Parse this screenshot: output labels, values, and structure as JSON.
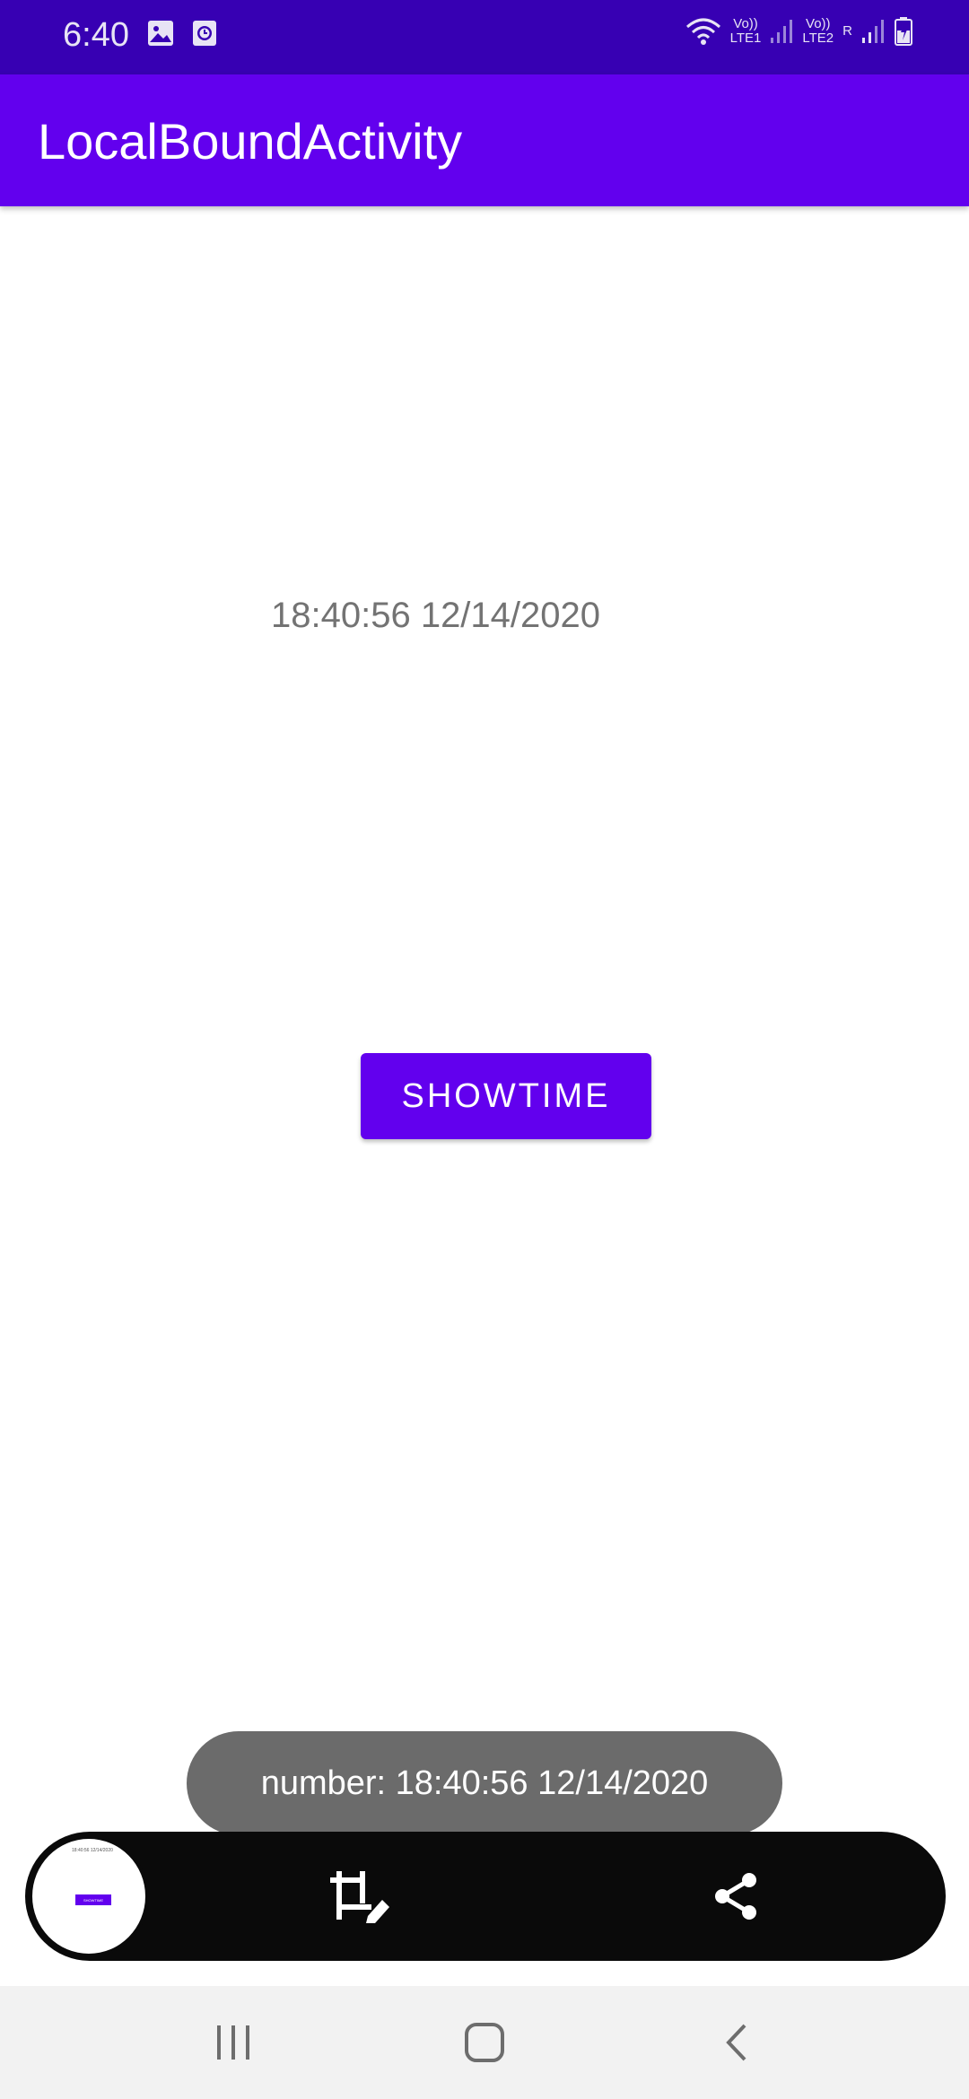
{
  "status_bar": {
    "time": "6:40",
    "sim1_label": "Vo))\nLTE1",
    "sim2_label": "Vo))\nLTE2",
    "roaming": "R",
    "icons": [
      "image-icon",
      "clock-icon",
      "wifi-icon",
      "signal-icon",
      "battery-icon"
    ]
  },
  "app_bar": {
    "title": "LocalBoundActivity"
  },
  "content": {
    "time_text": "18:40:56 12/14/2020",
    "showtime_label": "SHOWTIME"
  },
  "toast": {
    "message": "number: 18:40:56 12/14/2020"
  },
  "screenshot_toolbar": {
    "thumb_time_text": "18:40:56 12/14/2020",
    "thumb_button_label": "SHOWTIME",
    "icons": [
      "crop-edit-icon",
      "share-icon"
    ]
  },
  "nav_bar": {
    "icons": [
      "recents-icon",
      "home-icon",
      "back-icon"
    ]
  },
  "colors": {
    "status_bar": "#3700b3",
    "primary": "#6200ee",
    "toast": "#6b6b6b",
    "toolbar": "#0a0a0a",
    "nav_bar": "#f2f2f2"
  }
}
